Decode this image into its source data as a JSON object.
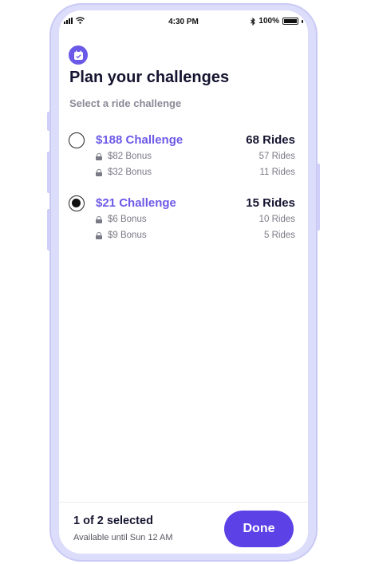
{
  "status_bar": {
    "time": "4:30 PM",
    "battery": "100%"
  },
  "page": {
    "title": "Plan your challenges",
    "subtitle": "Select a ride challenge"
  },
  "challenges": [
    {
      "name": "$188 Challenge",
      "total_rides": "68 Rides",
      "selected": false,
      "bonuses": [
        {
          "label": "$82 Bonus",
          "rides": "57 Rides"
        },
        {
          "label": "$32 Bonus",
          "rides": "11 Rides"
        }
      ]
    },
    {
      "name": "$21 Challenge",
      "total_rides": "15 Rides",
      "selected": true,
      "bonuses": [
        {
          "label": "$6 Bonus",
          "rides": "10 Rides"
        },
        {
          "label": "$9 Bonus",
          "rides": "5 Rides"
        }
      ]
    }
  ],
  "footer": {
    "selected_count": "1 of 2 selected",
    "availability": "Available until Sun 12 AM",
    "done_label": "Done"
  },
  "colors": {
    "accent": "#6b5ae8",
    "button": "#5b41e6",
    "phone_frame": "#dcdcfb"
  }
}
